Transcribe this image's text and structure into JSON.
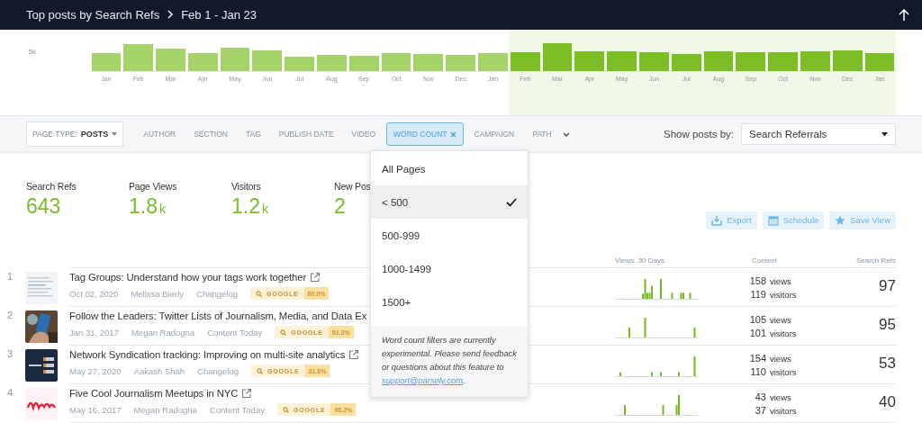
{
  "header": {
    "title": "Top posts by Search Refs",
    "date_range": "Feb 1 - Jan 23"
  },
  "trend_chart": {
    "y_tick": "5k",
    "months": [
      {
        "label": "Jan",
        "highlighted": false
      },
      {
        "label": "Feb",
        "highlighted": false
      },
      {
        "label": "Mar",
        "highlighted": false
      },
      {
        "label": "Apr",
        "highlighted": false
      },
      {
        "label": "May",
        "highlighted": false
      },
      {
        "label": "Jun",
        "highlighted": false
      },
      {
        "label": "Jul",
        "highlighted": false
      },
      {
        "label": "Aug",
        "highlighted": false
      },
      {
        "label": "Sep",
        "highlighted": false
      },
      {
        "label": "Oct",
        "highlighted": false
      },
      {
        "label": "Nov",
        "highlighted": false
      },
      {
        "label": "Dec",
        "highlighted": false
      },
      {
        "label": "Jan",
        "highlighted": false
      },
      {
        "label": "Feb",
        "highlighted": true
      },
      {
        "label": "Mar",
        "highlighted": true
      },
      {
        "label": "Apr",
        "highlighted": true
      },
      {
        "label": "May",
        "highlighted": true
      },
      {
        "label": "Jun",
        "highlighted": true
      },
      {
        "label": "Jul",
        "highlighted": true
      },
      {
        "label": "Aug",
        "highlighted": true
      },
      {
        "label": "Sep",
        "highlighted": true
      },
      {
        "label": "Oct",
        "highlighted": true
      },
      {
        "label": "Nov",
        "highlighted": true
      },
      {
        "label": "Dec",
        "highlighted": true
      },
      {
        "label": "Jan",
        "highlighted": true
      }
    ]
  },
  "filter_bar": {
    "page_type": {
      "label": "PAGE TYPE:",
      "value": "POSTS"
    },
    "filters": [
      {
        "label": "AUTHOR",
        "active": false
      },
      {
        "label": "SECTION",
        "active": false
      },
      {
        "label": "TAG",
        "active": false
      },
      {
        "label": "PUBLISH DATE",
        "active": false
      },
      {
        "label": "VIDEO",
        "active": false
      },
      {
        "label": "WORD COUNT",
        "active": true
      },
      {
        "label": "CAMPAIGN",
        "active": false
      },
      {
        "label": "PATH",
        "active": false
      }
    ],
    "show_by": {
      "label": "Show posts by:",
      "value": "Search Referrals"
    }
  },
  "filter_menu": {
    "options": [
      {
        "label": "All Pages",
        "selected": false
      },
      {
        "label": "< 500",
        "selected": true
      },
      {
        "label": "500-999",
        "selected": false
      },
      {
        "label": "1000-1499",
        "selected": false
      },
      {
        "label": "1500+",
        "selected": false
      }
    ],
    "note": "Word count filters are currently experimental. Please send feedback or questions about this feature to",
    "note_link": "support@parsely.com",
    "note_end": "."
  },
  "metrics": [
    {
      "label": "Search Refs",
      "value": "643"
    },
    {
      "label": "Page Views",
      "value": "1.8",
      "unit": "k"
    },
    {
      "label": "Visitors",
      "value": "1.2",
      "unit": "k"
    },
    {
      "label": "New Pos",
      "value": "2"
    }
  ],
  "actions": [
    {
      "label": "Export",
      "kind": "export"
    },
    {
      "label": "Schedule",
      "kind": "schedule"
    },
    {
      "label": "Save View",
      "kind": "save"
    }
  ],
  "table": {
    "columns": [
      "Views: 30 Days",
      "Context",
      "Search Refs"
    ],
    "rows": [
      {
        "rank": "1",
        "title": "Tag Groups: Understand how your tags work together",
        "link_icon": true,
        "date": "Oct 02, 2020",
        "author": "Melissa Bierly",
        "section": "Changelog",
        "referrer": "GOOGLE",
        "share": "60.0%",
        "views": "158",
        "views_unit": "views",
        "visitors": "119",
        "visitors_unit": "visitors",
        "search_refs": "97"
      },
      {
        "rank": "2",
        "title": "Follow the Leaders: Twitter Lists of Journalism, Media, and Data Ex",
        "link_icon": false,
        "date": "Jan 31, 2017",
        "author": "Megan Radogna",
        "section": "Content Today",
        "referrer": "GOOGLE",
        "share": "91.3%",
        "views": "105",
        "views_unit": "views",
        "visitors": "101",
        "visitors_unit": "visitors",
        "search_refs": "95"
      },
      {
        "rank": "3",
        "title": "Network Syndication tracking: Improving on multi-site analytics",
        "link_icon": true,
        "date": "May 27, 2020",
        "author": "Aakash Shah",
        "section": "Changelog",
        "referrer": "GOOGLE",
        "share": "31.6%",
        "views": "154",
        "views_unit": "views",
        "visitors": "110",
        "visitors_unit": "visitors",
        "search_refs": "53"
      },
      {
        "rank": "4",
        "title": "Five Cool Journalism Meetups in NYC",
        "link_icon": true,
        "date": "May 16, 2017",
        "author": "Megan Radogna",
        "section": "Content Today",
        "referrer": "GOOGLE",
        "share": "95.2%",
        "views": "43",
        "views_unit": "views",
        "visitors": "37",
        "visitors_unit": "visitors",
        "search_refs": "40"
      }
    ]
  }
}
